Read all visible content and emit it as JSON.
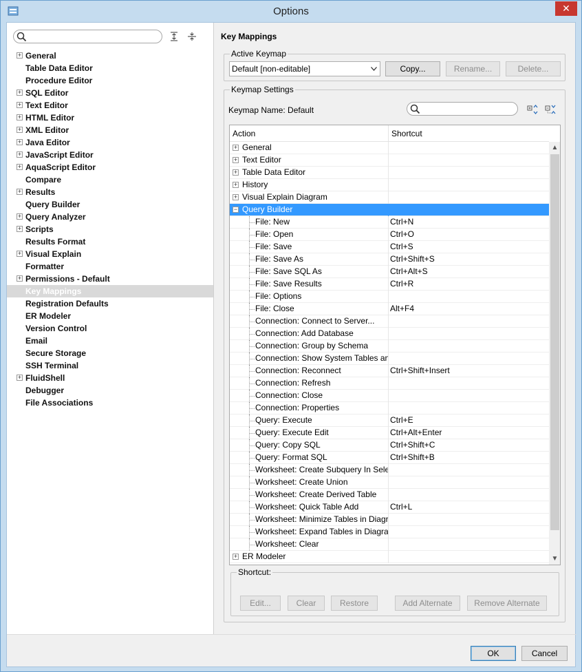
{
  "window": {
    "title": "Options",
    "close_symbol": "✕"
  },
  "nav": {
    "search_placeholder": "",
    "items": [
      {
        "label": "General",
        "expandable": true
      },
      {
        "label": "Table Data Editor",
        "expandable": false
      },
      {
        "label": "Procedure Editor",
        "expandable": false
      },
      {
        "label": "SQL Editor",
        "expandable": true
      },
      {
        "label": "Text Editor",
        "expandable": true
      },
      {
        "label": "HTML Editor",
        "expandable": true
      },
      {
        "label": "XML Editor",
        "expandable": true
      },
      {
        "label": "Java Editor",
        "expandable": true
      },
      {
        "label": "JavaScript Editor",
        "expandable": true
      },
      {
        "label": "AquaScript Editor",
        "expandable": true
      },
      {
        "label": "Compare",
        "expandable": false
      },
      {
        "label": "Results",
        "expandable": true
      },
      {
        "label": "Query Builder",
        "expandable": false
      },
      {
        "label": "Query Analyzer",
        "expandable": true
      },
      {
        "label": "Scripts",
        "expandable": true
      },
      {
        "label": "Results Format",
        "expandable": false
      },
      {
        "label": "Visual Explain",
        "expandable": true
      },
      {
        "label": "Formatter",
        "expandable": false
      },
      {
        "label": "Permissions - Default",
        "expandable": true
      },
      {
        "label": "Key Mappings",
        "expandable": false,
        "selected": true
      },
      {
        "label": "Registration Defaults",
        "expandable": false
      },
      {
        "label": "ER Modeler",
        "expandable": false
      },
      {
        "label": "Version Control",
        "expandable": false
      },
      {
        "label": "Email",
        "expandable": false
      },
      {
        "label": "Secure Storage",
        "expandable": false
      },
      {
        "label": "SSH Terminal",
        "expandable": false
      },
      {
        "label": "FluidShell",
        "expandable": true
      },
      {
        "label": "Debugger",
        "expandable": false
      },
      {
        "label": "File Associations",
        "expandable": false
      }
    ]
  },
  "panel": {
    "title": "Key Mappings",
    "active_keymap": {
      "label": "Active Keymap",
      "selected": "Default [non-editable]",
      "copy": "Copy...",
      "rename": "Rename...",
      "delete": "Delete..."
    },
    "settings": {
      "label": "Keymap Settings",
      "name_label": "Keymap Name: Default",
      "search_placeholder": ""
    },
    "table": {
      "headers": [
        "Action",
        "Shortcut"
      ],
      "rows": [
        {
          "action": "General",
          "shortcut": "",
          "type": "group",
          "expanded": false
        },
        {
          "action": "Text Editor",
          "shortcut": "",
          "type": "group",
          "expanded": false
        },
        {
          "action": "Table Data Editor",
          "shortcut": "",
          "type": "group",
          "expanded": false
        },
        {
          "action": "History",
          "shortcut": "",
          "type": "group",
          "expanded": false
        },
        {
          "action": "Visual Explain Diagram",
          "shortcut": "",
          "type": "group",
          "expanded": false
        },
        {
          "action": "Query Builder",
          "shortcut": "",
          "type": "group",
          "expanded": true,
          "selected": true
        },
        {
          "action": "File: New",
          "shortcut": "Ctrl+N",
          "type": "child"
        },
        {
          "action": "File: Open",
          "shortcut": "Ctrl+O",
          "type": "child"
        },
        {
          "action": "File: Save",
          "shortcut": "Ctrl+S",
          "type": "child"
        },
        {
          "action": "File: Save As",
          "shortcut": "Ctrl+Shift+S",
          "type": "child"
        },
        {
          "action": "File: Save SQL As",
          "shortcut": "Ctrl+Alt+S",
          "type": "child"
        },
        {
          "action": "File: Save Results",
          "shortcut": "Ctrl+R",
          "type": "child"
        },
        {
          "action": "File: Options",
          "shortcut": "",
          "type": "child"
        },
        {
          "action": "File: Close",
          "shortcut": "Alt+F4",
          "type": "child"
        },
        {
          "action": "Connection: Connect to Server...",
          "shortcut": "",
          "type": "child"
        },
        {
          "action": "Connection: Add Database",
          "shortcut": "",
          "type": "child"
        },
        {
          "action": "Connection: Group by Schema",
          "shortcut": "",
          "type": "child"
        },
        {
          "action": "Connection: Show System Tables and Vie",
          "shortcut": "",
          "type": "child"
        },
        {
          "action": "Connection: Reconnect",
          "shortcut": "Ctrl+Shift+Insert",
          "type": "child"
        },
        {
          "action": "Connection: Refresh",
          "shortcut": "",
          "type": "child"
        },
        {
          "action": "Connection: Close",
          "shortcut": "",
          "type": "child"
        },
        {
          "action": "Connection: Properties",
          "shortcut": "",
          "type": "child"
        },
        {
          "action": "Query: Execute",
          "shortcut": "Ctrl+E",
          "type": "child"
        },
        {
          "action": "Query: Execute Edit",
          "shortcut": "Ctrl+Alt+Enter",
          "type": "child"
        },
        {
          "action": "Query: Copy SQL",
          "shortcut": "Ctrl+Shift+C",
          "type": "child"
        },
        {
          "action": "Query: Format SQL",
          "shortcut": "Ctrl+Shift+B",
          "type": "child"
        },
        {
          "action": "Worksheet: Create Subquery In Select",
          "shortcut": "",
          "type": "child"
        },
        {
          "action": "Worksheet: Create Union",
          "shortcut": "",
          "type": "child"
        },
        {
          "action": "Worksheet: Create Derived Table",
          "shortcut": "",
          "type": "child"
        },
        {
          "action": "Worksheet: Quick Table Add",
          "shortcut": "Ctrl+L",
          "type": "child"
        },
        {
          "action": "Worksheet: Minimize Tables in Diagram",
          "shortcut": "",
          "type": "child"
        },
        {
          "action": "Worksheet: Expand Tables in Diagram",
          "shortcut": "",
          "type": "child"
        },
        {
          "action": "Worksheet: Clear",
          "shortcut": "",
          "type": "child"
        },
        {
          "action": "ER Modeler",
          "shortcut": "",
          "type": "group",
          "expanded": false
        }
      ]
    },
    "shortcut_group": {
      "label": "Shortcut:",
      "edit": "Edit...",
      "clear": "Clear",
      "restore": "Restore",
      "add_alternate": "Add Alternate",
      "remove_alternate": "Remove Alternate"
    }
  },
  "footer": {
    "ok": "OK",
    "cancel": "Cancel"
  },
  "colors": {
    "selection": "#3399ff",
    "nav_selected": "#d9d9d9",
    "close": "#c7372f"
  }
}
